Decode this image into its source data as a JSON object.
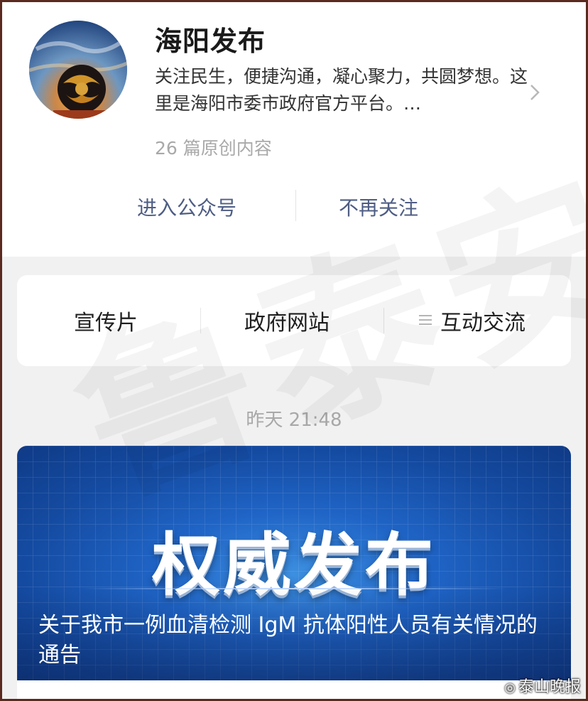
{
  "account": {
    "name": "海阳发布",
    "description": "关注民生，便捷沟通，凝心聚力，共圆梦想。这里是海阳市委市政府官方平台。…",
    "original_count": "26 篇原创内容"
  },
  "actions": {
    "enter": "进入公众号",
    "unfollow": "不再关注"
  },
  "menu": {
    "items": [
      "宣传片",
      "政府网站",
      "互动交流"
    ]
  },
  "message": {
    "time": "昨天 21:48"
  },
  "article": {
    "cover_text": "权威发布",
    "title": "关于我市一例血清检测 IgM 抗体阳性人员有关情况的通告"
  },
  "watermark": "鲁泰安",
  "source": "泰山晚报",
  "icons": [
    "avatar-image",
    "chevron-right-icon",
    "menu-list-icon",
    "weibo-icon"
  ]
}
